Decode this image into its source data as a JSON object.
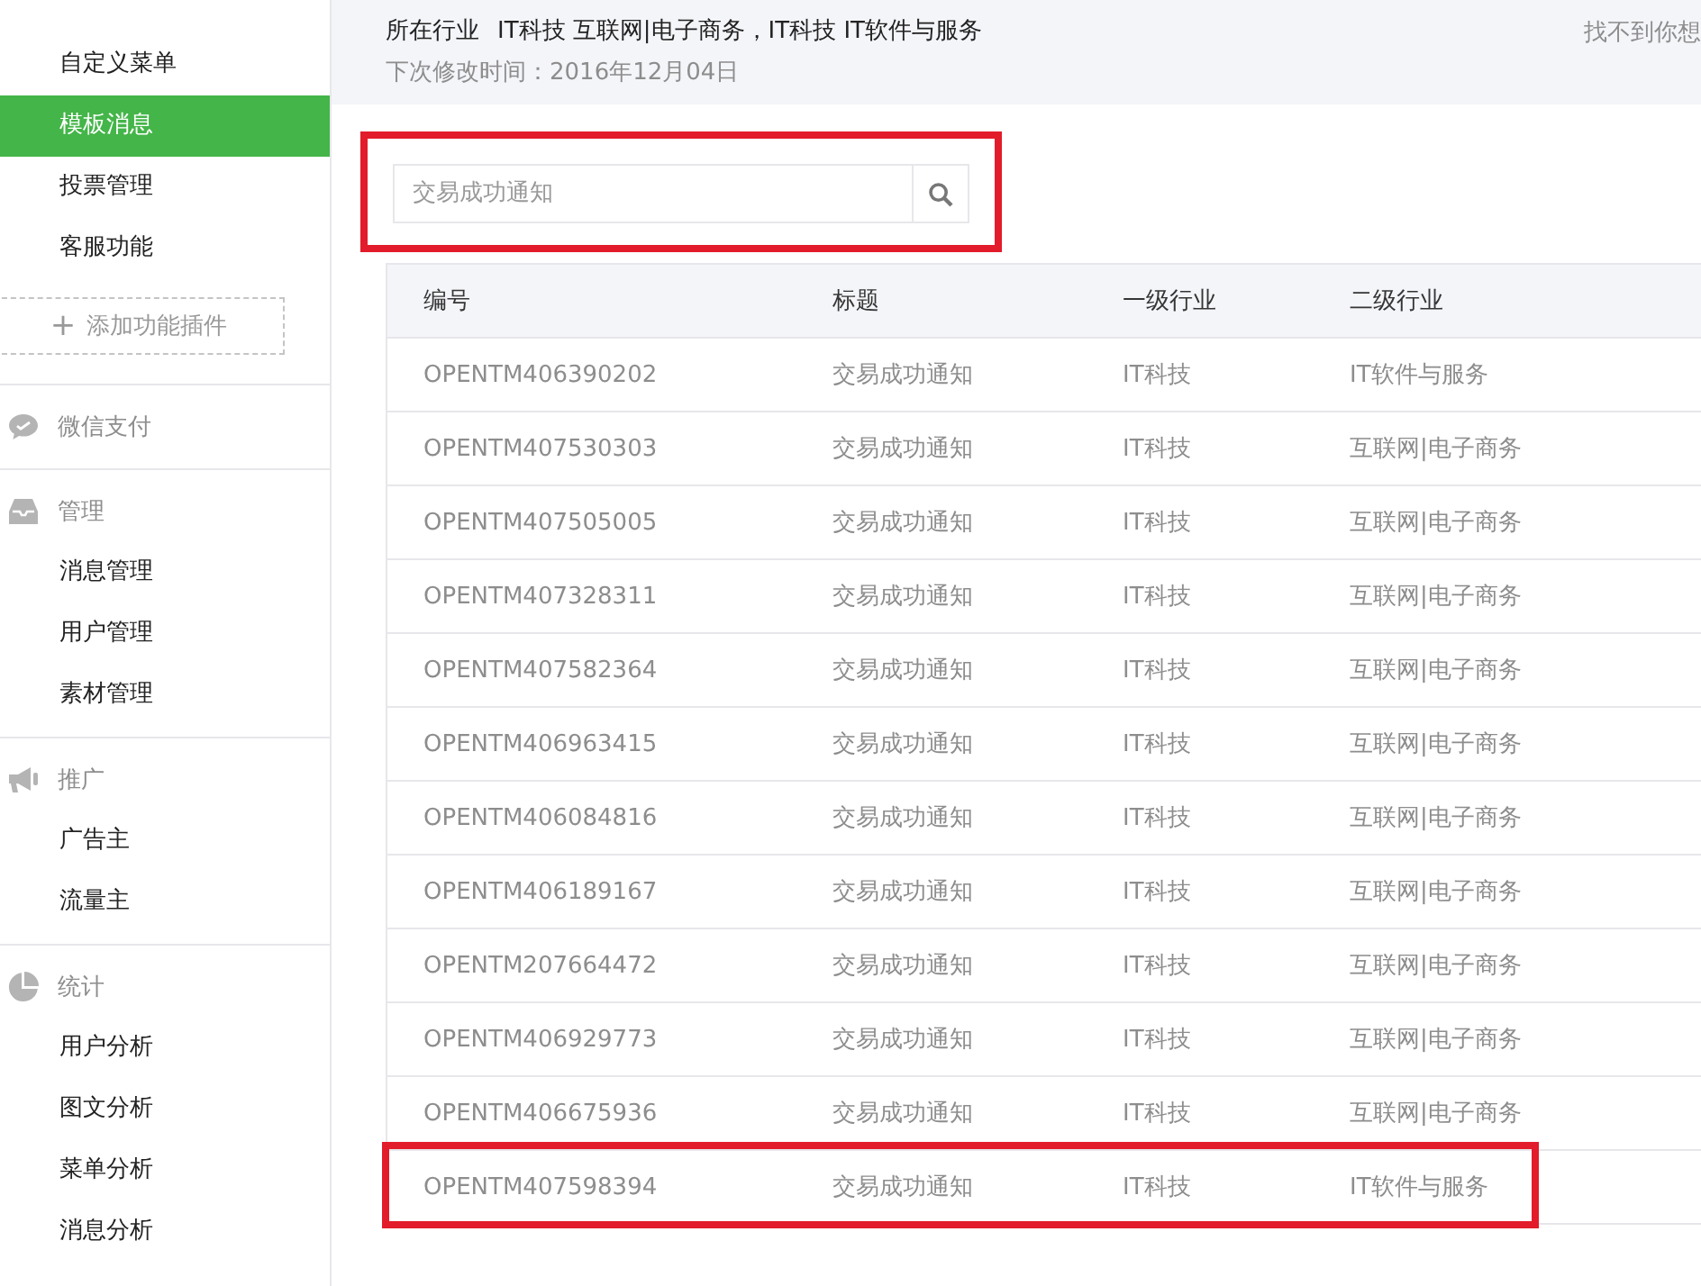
{
  "sidebar": {
    "sections": [
      {
        "items": [
          {
            "label": "自定义菜单",
            "selected": false
          },
          {
            "label": "模板消息",
            "selected": true
          },
          {
            "label": "投票管理",
            "selected": false
          },
          {
            "label": "客服功能",
            "selected": false
          }
        ],
        "add_button": {
          "icon": "+",
          "label": "添加功能插件"
        }
      },
      {
        "header": {
          "label": "微信支付",
          "kind": "chat"
        }
      },
      {
        "header": {
          "label": "管理",
          "kind": "tray"
        },
        "items": [
          {
            "label": "消息管理",
            "selected": false
          },
          {
            "label": "用户管理",
            "selected": false
          },
          {
            "label": "素材管理",
            "selected": false
          }
        ]
      },
      {
        "header": {
          "label": "推广",
          "kind": "megaphone"
        },
        "items": [
          {
            "label": "广告主",
            "selected": false
          },
          {
            "label": "流量主",
            "selected": false
          }
        ]
      },
      {
        "header": {
          "label": "统计",
          "kind": "pie"
        },
        "items": [
          {
            "label": "用户分析",
            "selected": false
          },
          {
            "label": "图文分析",
            "selected": false
          },
          {
            "label": "菜单分析",
            "selected": false
          },
          {
            "label": "消息分析",
            "selected": false
          }
        ]
      }
    ]
  },
  "info": {
    "industry_label": "所在行业",
    "industry_value": "IT科技 互联网|电子商务，IT科技 IT软件与服务",
    "next_change": "下次修改时间：2016年12月04日",
    "right_link": "找不到你想"
  },
  "search": {
    "placeholder": "交易成功通知",
    "highlighted": true
  },
  "table": {
    "columns": [
      "编号",
      "标题",
      "一级行业",
      "二级行业"
    ],
    "rows": [
      {
        "cells": [
          "OPENTM406390202",
          "交易成功通知",
          "IT科技",
          "IT软件与服务"
        ],
        "highlighted": false
      },
      {
        "cells": [
          "OPENTM407530303",
          "交易成功通知",
          "IT科技",
          "互联网|电子商务"
        ],
        "highlighted": false
      },
      {
        "cells": [
          "OPENTM407505005",
          "交易成功通知",
          "IT科技",
          "互联网|电子商务"
        ],
        "highlighted": false
      },
      {
        "cells": [
          "OPENTM407328311",
          "交易成功通知",
          "IT科技",
          "互联网|电子商务"
        ],
        "highlighted": false
      },
      {
        "cells": [
          "OPENTM407582364",
          "交易成功通知",
          "IT科技",
          "互联网|电子商务"
        ],
        "highlighted": false
      },
      {
        "cells": [
          "OPENTM406963415",
          "交易成功通知",
          "IT科技",
          "互联网|电子商务"
        ],
        "highlighted": false
      },
      {
        "cells": [
          "OPENTM406084816",
          "交易成功通知",
          "IT科技",
          "互联网|电子商务"
        ],
        "highlighted": false
      },
      {
        "cells": [
          "OPENTM406189167",
          "交易成功通知",
          "IT科技",
          "互联网|电子商务"
        ],
        "highlighted": false
      },
      {
        "cells": [
          "OPENTM207664472",
          "交易成功通知",
          "IT科技",
          "互联网|电子商务"
        ],
        "highlighted": false
      },
      {
        "cells": [
          "OPENTM406929773",
          "交易成功通知",
          "IT科技",
          "互联网|电子商务"
        ],
        "highlighted": false
      },
      {
        "cells": [
          "OPENTM406675936",
          "交易成功通知",
          "IT科技",
          "互联网|电子商务"
        ],
        "highlighted": false
      },
      {
        "cells": [
          "OPENTM407598394",
          "交易成功通知",
          "IT科技",
          "IT软件与服务"
        ],
        "highlighted": true
      }
    ]
  }
}
